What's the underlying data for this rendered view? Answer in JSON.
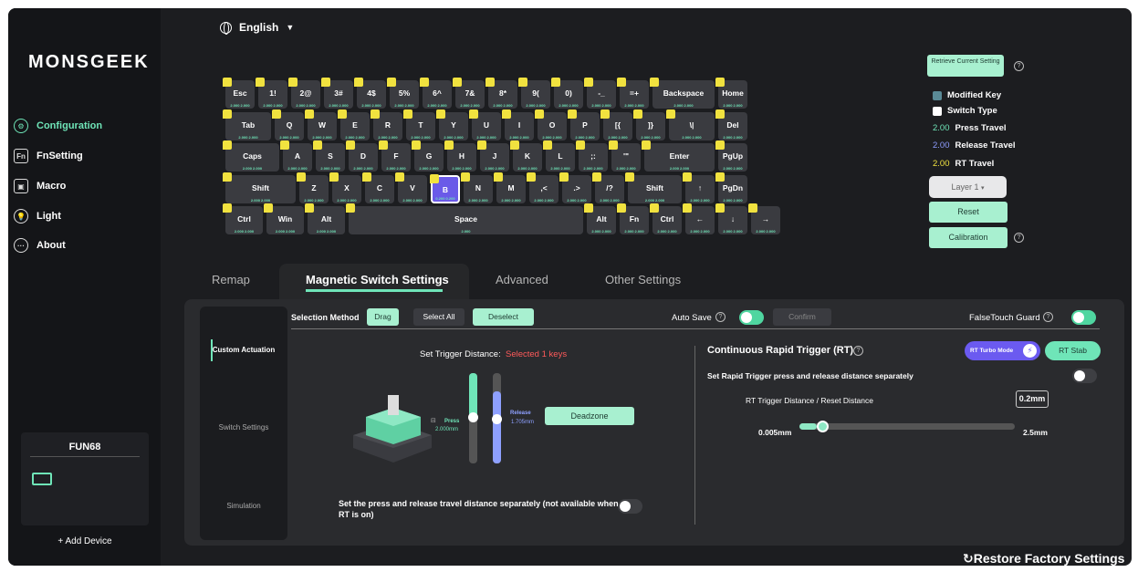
{
  "app": {
    "logo": "MONSGEEK",
    "language": "English"
  },
  "sidebar": {
    "items": [
      {
        "label": "Configuration",
        "icon": "configuration-icon",
        "glyph": "⚙"
      },
      {
        "label": "FnSetting",
        "icon": "fn-icon",
        "glyph": "Fn"
      },
      {
        "label": "Macro",
        "icon": "macro-icon",
        "glyph": "▣"
      },
      {
        "label": "Light",
        "icon": "light-bulb-icon",
        "glyph": "💡"
      },
      {
        "label": "About",
        "icon": "about-icon",
        "glyph": "···"
      }
    ],
    "device": {
      "name": "FUN68",
      "icon": "keyboard-icon"
    },
    "add_device": "+ Add Device"
  },
  "keyboard": {
    "rows": [
      [
        {
          "l": "Esc",
          "s": "2.000 2.000"
        },
        {
          "l": "1!",
          "s": "2.000 2.000"
        },
        {
          "l": "2@",
          "s": "2.000 2.000"
        },
        {
          "l": "3#",
          "s": "2.000 2.000"
        },
        {
          "l": "4$",
          "s": "2.000 2.000"
        },
        {
          "l": "5%",
          "s": "2.000 2.000"
        },
        {
          "l": "6^",
          "s": "2.000 2.000"
        },
        {
          "l": "7&",
          "s": "2.000 2.000"
        },
        {
          "l": "8*",
          "s": "2.000 2.000"
        },
        {
          "l": "9(",
          "s": "2.000 2.000"
        },
        {
          "l": "0)",
          "s": "2.000 2.000"
        },
        {
          "l": "-_",
          "s": "2.000 2.000"
        },
        {
          "l": "=+",
          "s": "2.000 2.000"
        },
        {
          "l": "Backspace",
          "s": "2.000 2.000"
        },
        {
          "l": "Home",
          "s": "2.000 2.000"
        }
      ],
      [
        {
          "l": "Tab",
          "s": "2.000 2.000"
        },
        {
          "l": "Q",
          "s": "2.000 2.000"
        },
        {
          "l": "W",
          "s": "2.000 2.000"
        },
        {
          "l": "E",
          "s": "2.000 2.000"
        },
        {
          "l": "R",
          "s": "2.000 2.000"
        },
        {
          "l": "T",
          "s": "2.000 2.000"
        },
        {
          "l": "Y",
          "s": "2.000 2.000"
        },
        {
          "l": "U",
          "s": "2.000 2.000"
        },
        {
          "l": "I",
          "s": "2.000 2.000"
        },
        {
          "l": "O",
          "s": "2.000 2.000"
        },
        {
          "l": "P",
          "s": "2.000 2.000"
        },
        {
          "l": "[{",
          "s": "2.000 2.000"
        },
        {
          "l": "]}",
          "s": "2.000 2.000"
        },
        {
          "l": "\\|",
          "s": "2.000 2.000"
        },
        {
          "l": "Del",
          "s": "2.000 2.000"
        }
      ],
      [
        {
          "l": "Caps",
          "s": "2.000 2.000"
        },
        {
          "l": "A",
          "s": "2.000 2.000"
        },
        {
          "l": "S",
          "s": "2.000 2.000"
        },
        {
          "l": "D",
          "s": "2.000 2.000"
        },
        {
          "l": "F",
          "s": "2.000 2.000"
        },
        {
          "l": "G",
          "s": "2.000 2.000"
        },
        {
          "l": "H",
          "s": "2.000 2.000"
        },
        {
          "l": "J",
          "s": "2.000 2.000"
        },
        {
          "l": "K",
          "s": "2.000 2.000"
        },
        {
          "l": "L",
          "s": "2.000 2.000"
        },
        {
          "l": ";:",
          "s": "2.000 2.000"
        },
        {
          "l": "'\"",
          "s": "2.000 2.000"
        },
        {
          "l": "Enter",
          "s": "2.000 2.000"
        },
        {
          "l": "PgUp",
          "s": "2.000 2.000"
        }
      ],
      [
        {
          "l": "Shift",
          "s": "2.000 2.000"
        },
        {
          "l": "Z",
          "s": "2.000 2.000"
        },
        {
          "l": "X",
          "s": "2.000 2.000"
        },
        {
          "l": "C",
          "s": "2.000 2.000"
        },
        {
          "l": "V",
          "s": "2.000 2.000"
        },
        {
          "l": "B",
          "s": "0.200 0.200"
        },
        {
          "l": "N",
          "s": "2.000 2.000"
        },
        {
          "l": "M",
          "s": "2.000 2.000"
        },
        {
          "l": ",<",
          "s": "2.000 2.000"
        },
        {
          "l": ".>",
          "s": "2.000 2.000"
        },
        {
          "l": "/?",
          "s": "2.000 2.000"
        },
        {
          "l": "Shift",
          "s": "2.000 2.000"
        },
        {
          "l": "↑",
          "s": "2.000 2.000"
        },
        {
          "l": "PgDn",
          "s": "2.000 2.000"
        }
      ],
      [
        {
          "l": "Ctrl",
          "s": "2.000 2.000"
        },
        {
          "l": "Win",
          "s": "2.000 2.000"
        },
        {
          "l": "Alt",
          "s": "2.000 2.000"
        },
        {
          "l": "Space",
          "s": "2.000"
        },
        {
          "l": "Alt",
          "s": "2.000 2.000"
        },
        {
          "l": "Fn",
          "s": "2.000 2.000"
        },
        {
          "l": "Ctrl",
          "s": "2.000 2.000"
        },
        {
          "l": "←",
          "s": "2.000 2.000"
        },
        {
          "l": "↓",
          "s": "2.000 2.000"
        },
        {
          "l": "→",
          "s": "2.000 2.000"
        }
      ]
    ]
  },
  "right": {
    "retrieve": "Retrieve Current Setting",
    "legend": [
      {
        "label": "Modified Key",
        "color": "#5a8a96"
      },
      {
        "label": "Switch Type",
        "color": "#ffffff"
      },
      {
        "value": "2.00",
        "label": "Press Travel",
        "color": "#6fe5b8"
      },
      {
        "value": "2.00",
        "label": "Release Travel",
        "color": "#8e9cff"
      },
      {
        "value": "2.00",
        "label": "RT Travel",
        "color": "#f1e23f"
      }
    ],
    "layer": "Layer 1",
    "reset": "Reset",
    "calibration": "Calibration"
  },
  "tabs": [
    "Remap",
    "Magnetic Switch Settings",
    "Advanced",
    "Other Settings"
  ],
  "subnav": [
    "Custom Actuation",
    "Switch Settings",
    "Simulation"
  ],
  "settings": {
    "selection_method": "Selection Method",
    "drag": "Drag",
    "select_all": "Select All",
    "deselect": "Deselect",
    "auto_save": "Auto Save",
    "auto_save_on": true,
    "confirm": "Confirm",
    "falsetouch": "FalseTouch Guard",
    "falsetouch_on": true,
    "trigger_label": "Set Trigger Distance:",
    "selected": "Selected 1 keys",
    "press_label": "Press",
    "press_value": "2.000mm",
    "release_label": "Release",
    "release_value": "1.705mm",
    "deadzone": "Deadzone",
    "separate_note": "Set the press and release travel distance separately (not available when RT is on)",
    "rt_title": "Continuous Rapid Trigger (RT)",
    "rt_turbo": "RT Turbo Mode",
    "rt_stab": "RT Stab",
    "rt_separate": "Set Rapid Trigger press and release distance separately",
    "rt_distance_label": "RT Trigger Distance / Reset Distance",
    "rt_value": "0.2mm",
    "rt_min": "0.005mm",
    "rt_max": "2.5mm",
    "rt_fraction": 0.08,
    "press_fraction": 0.48,
    "release_fraction": 0.2
  },
  "footer": {
    "restore": "Restore Factory Settings"
  }
}
